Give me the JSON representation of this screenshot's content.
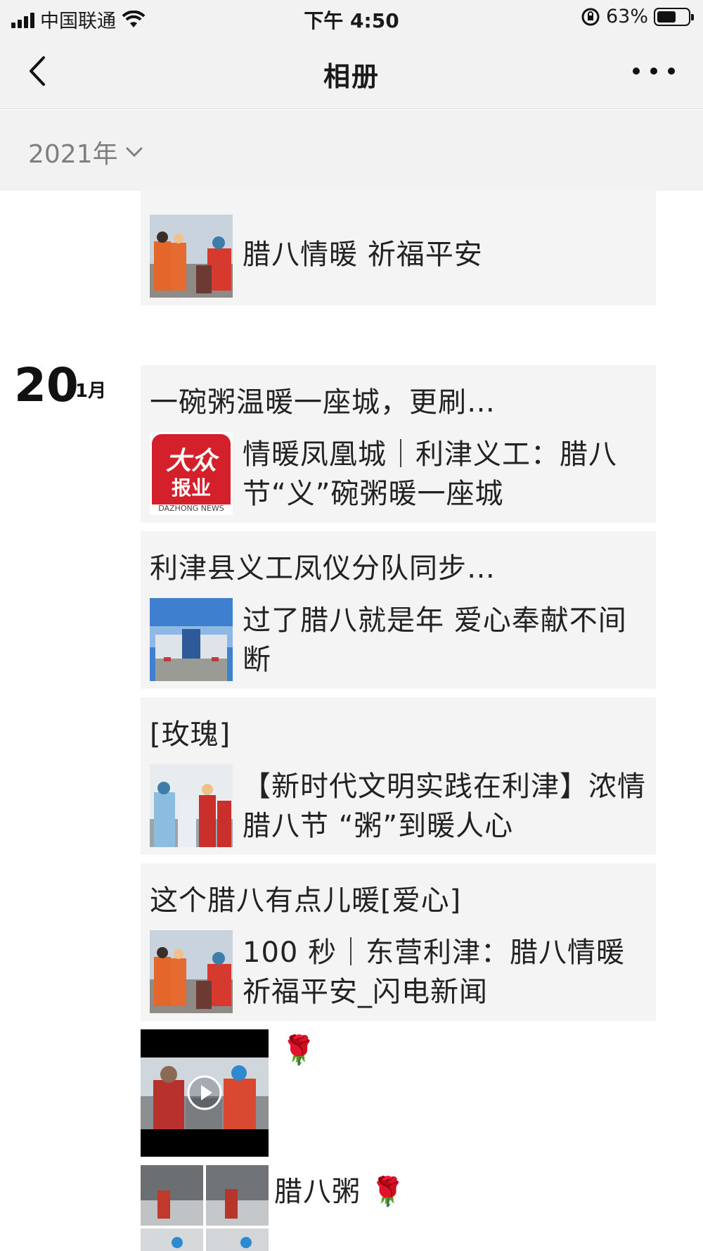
{
  "status_bar": {
    "carrier": "中国联通",
    "time": "下午 4:50",
    "battery_percent": "63%",
    "battery_level": 0.63
  },
  "nav": {
    "title": "相册"
  },
  "year_selector": {
    "label": "2021年"
  },
  "date_group": {
    "day": "20",
    "month": "1月"
  },
  "posts": [
    {
      "caption": "",
      "link_title": "腊八情暖 祈福平安",
      "thumb_icon": "sanitation-workers-photo"
    },
    {
      "caption": "一碗粥温暖一座城，更刷…",
      "link_title": "情暖凤凰城｜利津义工：腊八节“义”碗粥暖一座城",
      "thumb_icon": "dazhong-news-logo",
      "logo_text": "大众",
      "logo_sub": "报业",
      "logo_en": "DAZHONG NEWS"
    },
    {
      "caption": "利津县义工凤仪分队同步…",
      "link_title": "过了腊八就是年  爱心奉献不间断",
      "thumb_icon": "building-photo"
    },
    {
      "caption": "[玫瑰]",
      "link_title": "【新时代文明实践在利津】浓情腊八节 “粥”到暖人心",
      "thumb_icon": "volunteers-photo"
    },
    {
      "caption": "这个腊八有点儿暖[爱心]",
      "link_title": "100 秒｜东营利津：腊八情暖 祈福平安_闪电新闻",
      "thumb_icon": "sanitation-workers-photo"
    }
  ],
  "video_post": {
    "caption": "🌹",
    "thumb_icon": "kitchen-video-thumbnail"
  },
  "photo_post": {
    "caption": "腊八粥",
    "emoji": "🌹",
    "thumb_icon": "kitchen-photo-grid"
  },
  "colors": {
    "card_bg": "#f4f4f4",
    "bar_bg": "#f2f2f2",
    "logo_red": "#d3202a"
  }
}
